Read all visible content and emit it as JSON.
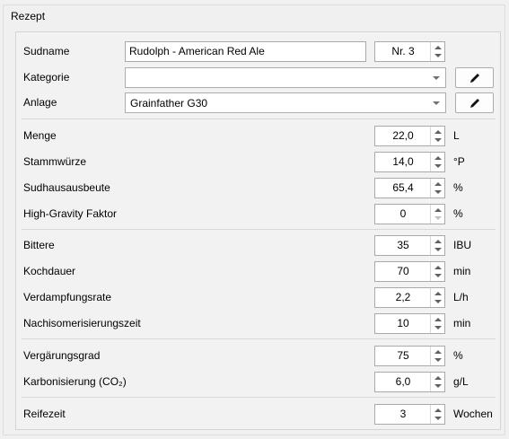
{
  "group_title": "Rezept",
  "sudname": {
    "label": "Sudname",
    "value": "Rudolph - American Red Ale",
    "number": "Nr. 3"
  },
  "kategorie": {
    "label": "Kategorie",
    "value": ""
  },
  "anlage": {
    "label": "Anlage",
    "value": "Grainfather G30"
  },
  "fields": {
    "menge": {
      "label": "Menge",
      "value": "22,0",
      "unit": "L"
    },
    "stammwuerze": {
      "label": "Stammwürze",
      "value": "14,0",
      "unit": "°P"
    },
    "sudhausausbeute": {
      "label": "Sudhausausbeute",
      "value": "65,4",
      "unit": "%"
    },
    "high_gravity": {
      "label": "High-Gravity Faktor",
      "value": "0",
      "unit": "%"
    },
    "bittere": {
      "label": "Bittere",
      "value": "35",
      "unit": "IBU"
    },
    "kochdauer": {
      "label": "Kochdauer",
      "value": "70",
      "unit": "min"
    },
    "verdampfungsrate": {
      "label": "Verdampfungsrate",
      "value": "2,2",
      "unit": "L/h"
    },
    "nachisomerisierungszeit": {
      "label": "Nachisomerisierungszeit",
      "value": "10",
      "unit": "min"
    },
    "vergaerungsgrad": {
      "label": "Vergärungsgrad",
      "value": "75",
      "unit": "%"
    },
    "karbonisierung": {
      "label": "Karbonisierung (CO₂)",
      "value": "6,0",
      "unit": "g/L"
    },
    "reifezeit": {
      "label": "Reifezeit",
      "value": "3",
      "unit": "Wochen"
    }
  },
  "icons": {
    "edit": "pencil-icon",
    "spin_up": "arrow-up-icon",
    "spin_down": "arrow-down-icon",
    "dropdown": "chevron-down-icon"
  }
}
